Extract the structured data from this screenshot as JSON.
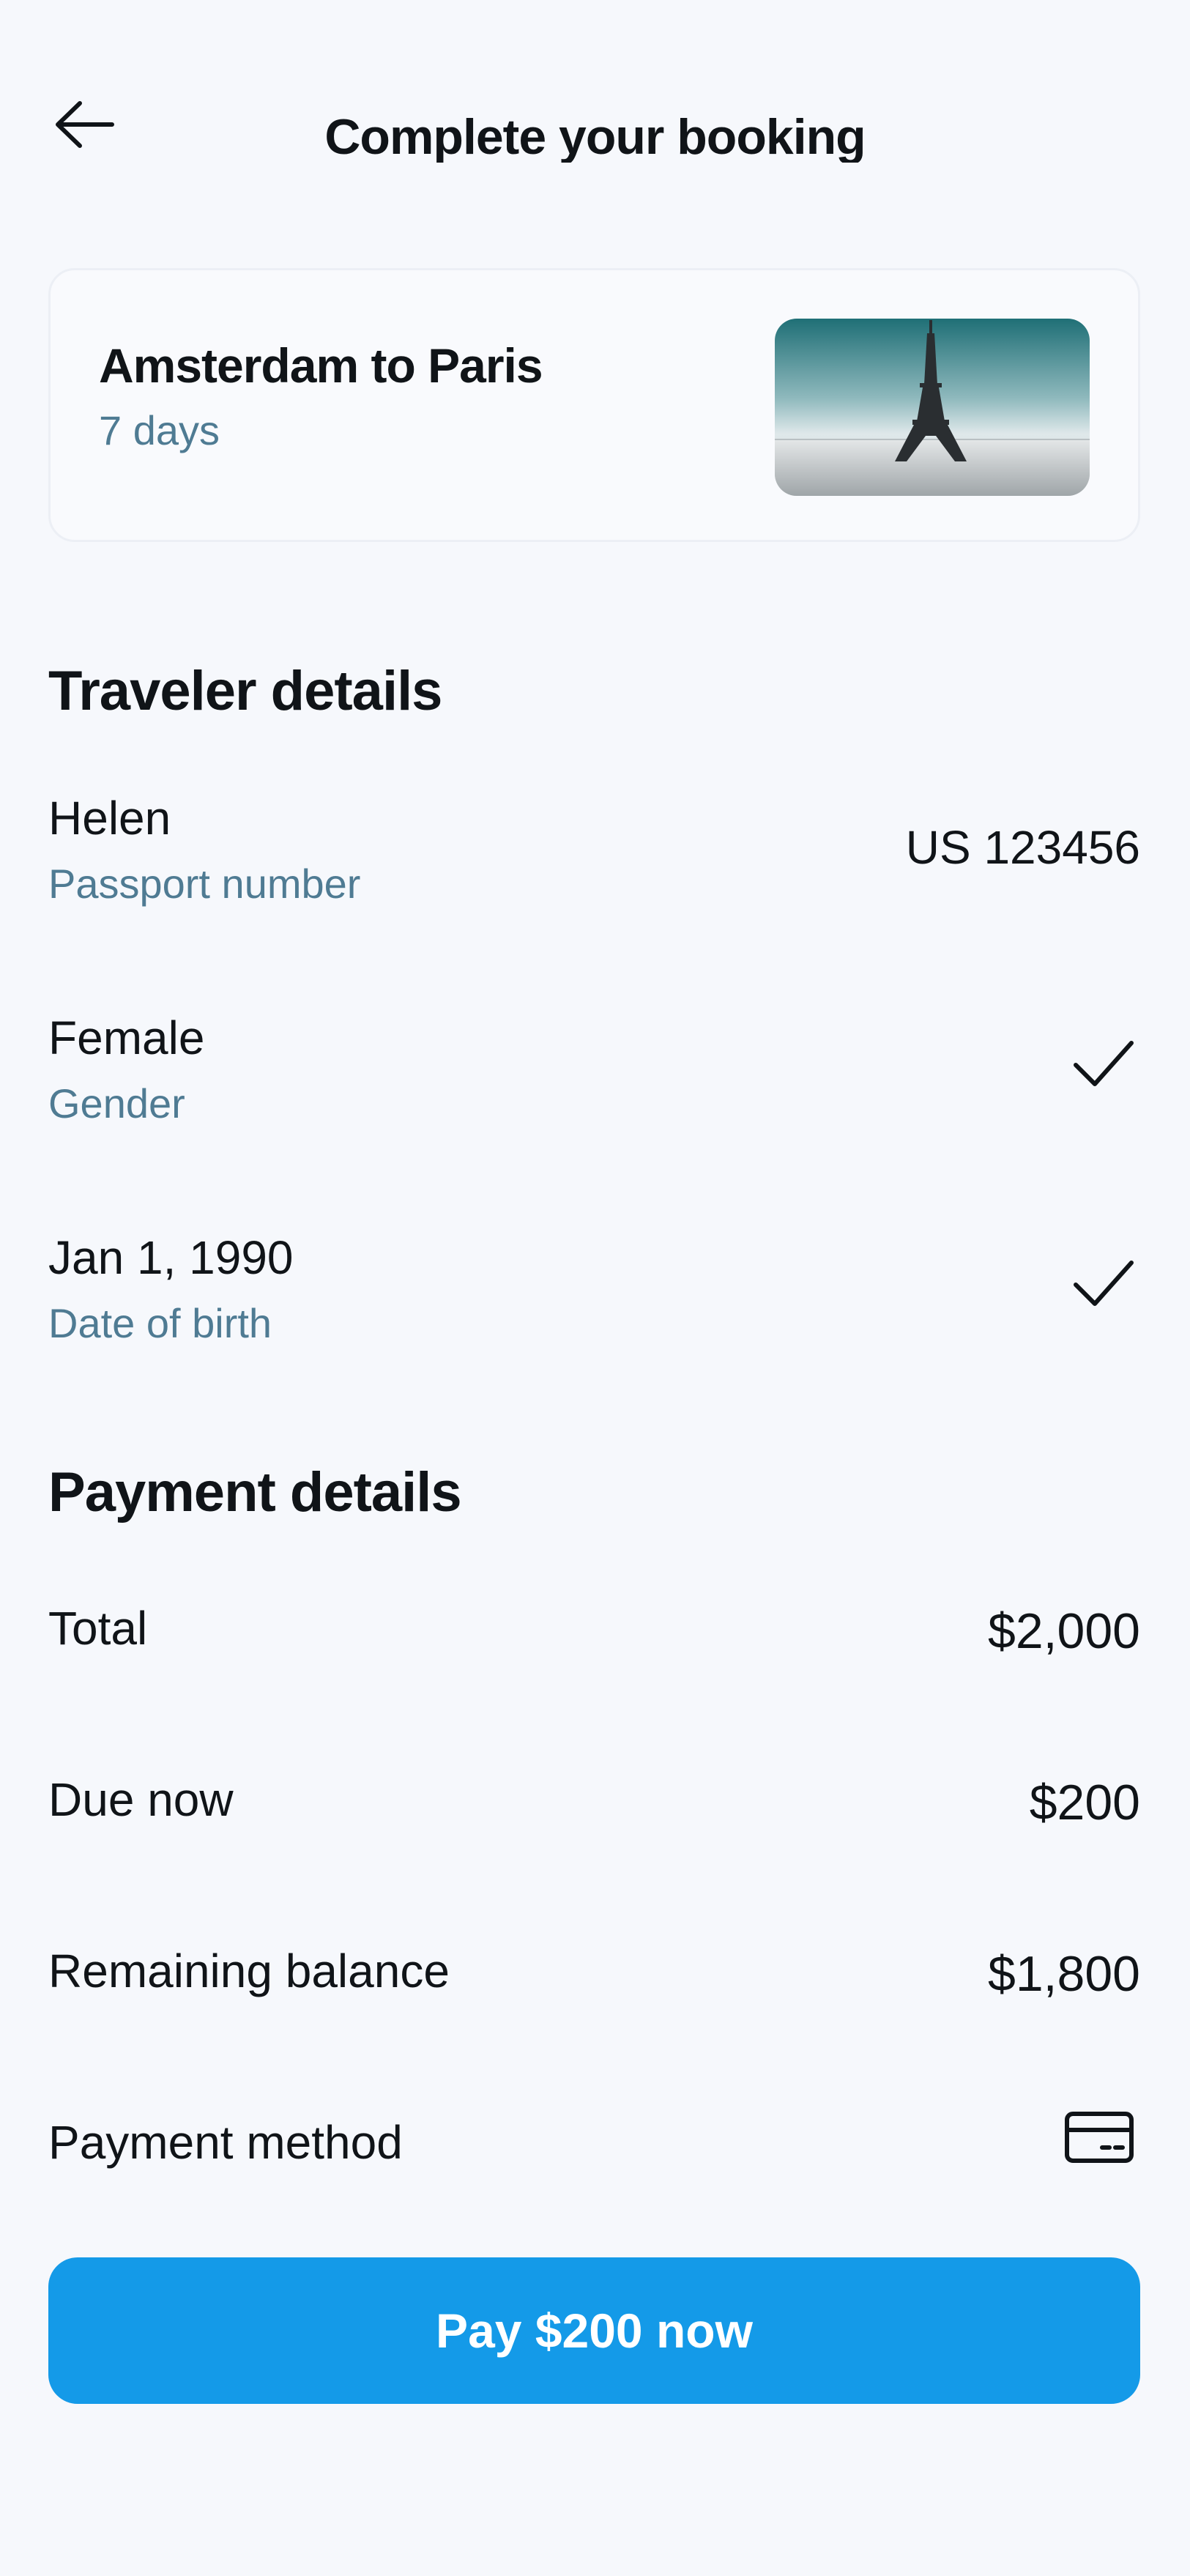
{
  "header": {
    "title": "Complete your booking",
    "back_icon": "arrow-left-icon"
  },
  "trip": {
    "title": "Amsterdam to Paris",
    "duration": "7 days",
    "image_subject": "eiffel-tower-photo"
  },
  "traveler": {
    "heading": "Traveler details",
    "rows": [
      {
        "primary": "Helen",
        "secondary": "Passport number",
        "value": "US 123456"
      },
      {
        "primary": "Female",
        "secondary": "Gender",
        "icon": "checkmark-icon"
      },
      {
        "primary": "Jan 1, 1990",
        "secondary": "Date of birth",
        "icon": "checkmark-icon"
      }
    ]
  },
  "payment": {
    "heading": "Payment details",
    "rows": [
      {
        "label": "Total",
        "value": "$2,000"
      },
      {
        "label": "Due now",
        "value": "$200"
      },
      {
        "label": "Remaining balance",
        "value": "$1,800"
      },
      {
        "label": "Payment method",
        "icon": "credit-card-icon"
      }
    ],
    "button_label": "Pay $200 now"
  },
  "colors": {
    "background": "#f6f8fc",
    "accent": "#149ae8",
    "secondary_text": "#4f7b93",
    "primary_text": "#101418"
  }
}
